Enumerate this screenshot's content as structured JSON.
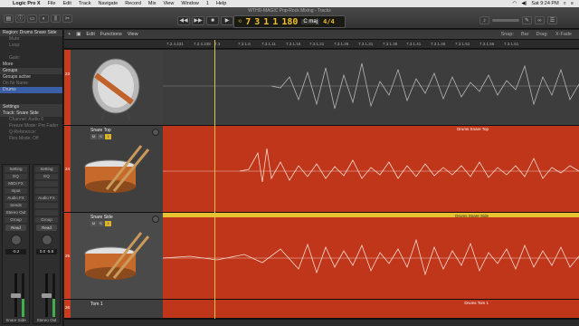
{
  "menubar": {
    "app": "Logic Pro X",
    "items": [
      "File",
      "Edit",
      "Track",
      "Navigate",
      "Record",
      "Mix",
      "View",
      "Window",
      "1",
      "Help"
    ],
    "clock": "Sat 9:24 PM"
  },
  "toolbar": {
    "window_title": "WTHD-MAGIC Pop-Rock Mixing - Tracks",
    "lcd": {
      "bar": "7",
      "beat": "3",
      "div": "1",
      "tick": "1",
      "tempo": "180",
      "key": "C maj",
      "sig": "4/4",
      "bar_label": "BAR",
      "beat_label": "BEAT",
      "tempo_label": "TEMPO",
      "sig_label": "KEY"
    }
  },
  "inspector": {
    "region_header": "Region: Drums Snare Side",
    "region_rows": [
      "Mute:",
      "Loop:",
      "",
      "Gain:"
    ],
    "more": "More",
    "groups_header": "Groups",
    "groups_active": "Groups active",
    "group_cols": [
      "On",
      "Nr",
      "Name"
    ],
    "group_row": "Drums",
    "settings": "Settings",
    "track_header": "Track: Snare Side",
    "track_rows": [
      "Channel: Audio 6",
      "Freeze Mode: Pre Fader",
      "Q-Reference:",
      "Flex Mode: Off"
    ],
    "strip_left": {
      "slots": [
        "Setting",
        "EQ",
        "MIDI FX",
        "Input",
        "Audio FX",
        "Sends",
        "Stereo Out",
        "Group",
        "Read"
      ],
      "value": "-5.2",
      "name": "Snare Side"
    },
    "strip_right": {
      "slots": [
        "Setting",
        "EQ",
        "",
        "",
        "Audio FX",
        "",
        "",
        "Group",
        "Read"
      ],
      "values": [
        "0.0",
        "-5.8"
      ],
      "name": "Stereo Out"
    }
  },
  "tracks_menu": {
    "edit": "Edit",
    "functions": "Functions",
    "view": "View",
    "snap_label": "Snap:",
    "snap_value": "Bar",
    "drag_label": "Drag:",
    "drag_value": "X-Fade"
  },
  "ruler_ticks": [
    "7.2.4.231",
    "7.2.4.238",
    "7.3",
    "7.3.1.6",
    "7.3.1.11",
    "7.3.1.16",
    "7.3.1.21",
    "7.3.1.26",
    "7.3.1.31",
    "7.3.1.36",
    "7.3.1.41",
    "7.3.1.46",
    "7.3.1.51",
    "7.3.1.56",
    "7.3.1.61"
  ],
  "tracks": [
    {
      "num": "23",
      "name": "",
      "region_label": ""
    },
    {
      "num": "24",
      "name": "Snare Top",
      "region_label": "Drums Snare Top"
    },
    {
      "num": "25",
      "name": "Snare Side",
      "region_label": "Drums Snare Side"
    },
    {
      "num": "26",
      "name": "Tom 1",
      "region_label": "Drums Tom 1"
    }
  ],
  "colors": {
    "track_red": "#c0361a",
    "accent_yellow": "#e9c232",
    "lcd_text": "#f0c030"
  }
}
